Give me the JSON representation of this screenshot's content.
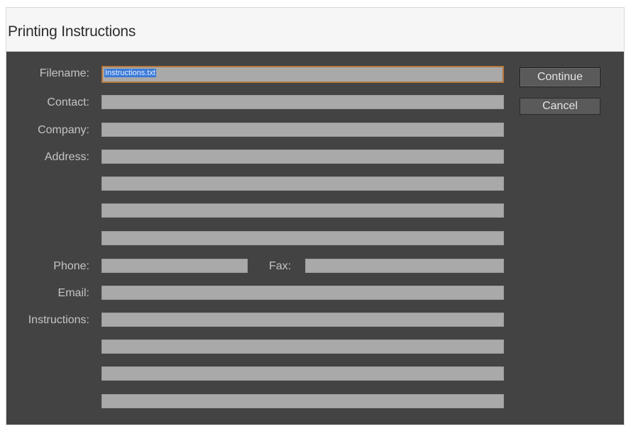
{
  "dialog": {
    "title": "Printing Instructions",
    "labels": {
      "filename": "Filename:",
      "contact": "Contact:",
      "company": "Company:",
      "address": "Address:",
      "phone": "Phone:",
      "fax": "Fax:",
      "email": "Email:",
      "instructions": "Instructions:"
    },
    "fields": {
      "filename": "Instructions.txt"
    },
    "buttons": {
      "continue": "Continue",
      "cancel": "Cancel"
    },
    "colors": {
      "background": "#434343",
      "field": "#a9a9a9",
      "focus_border": "#b5783e",
      "selection": "#3b7ad8"
    }
  }
}
